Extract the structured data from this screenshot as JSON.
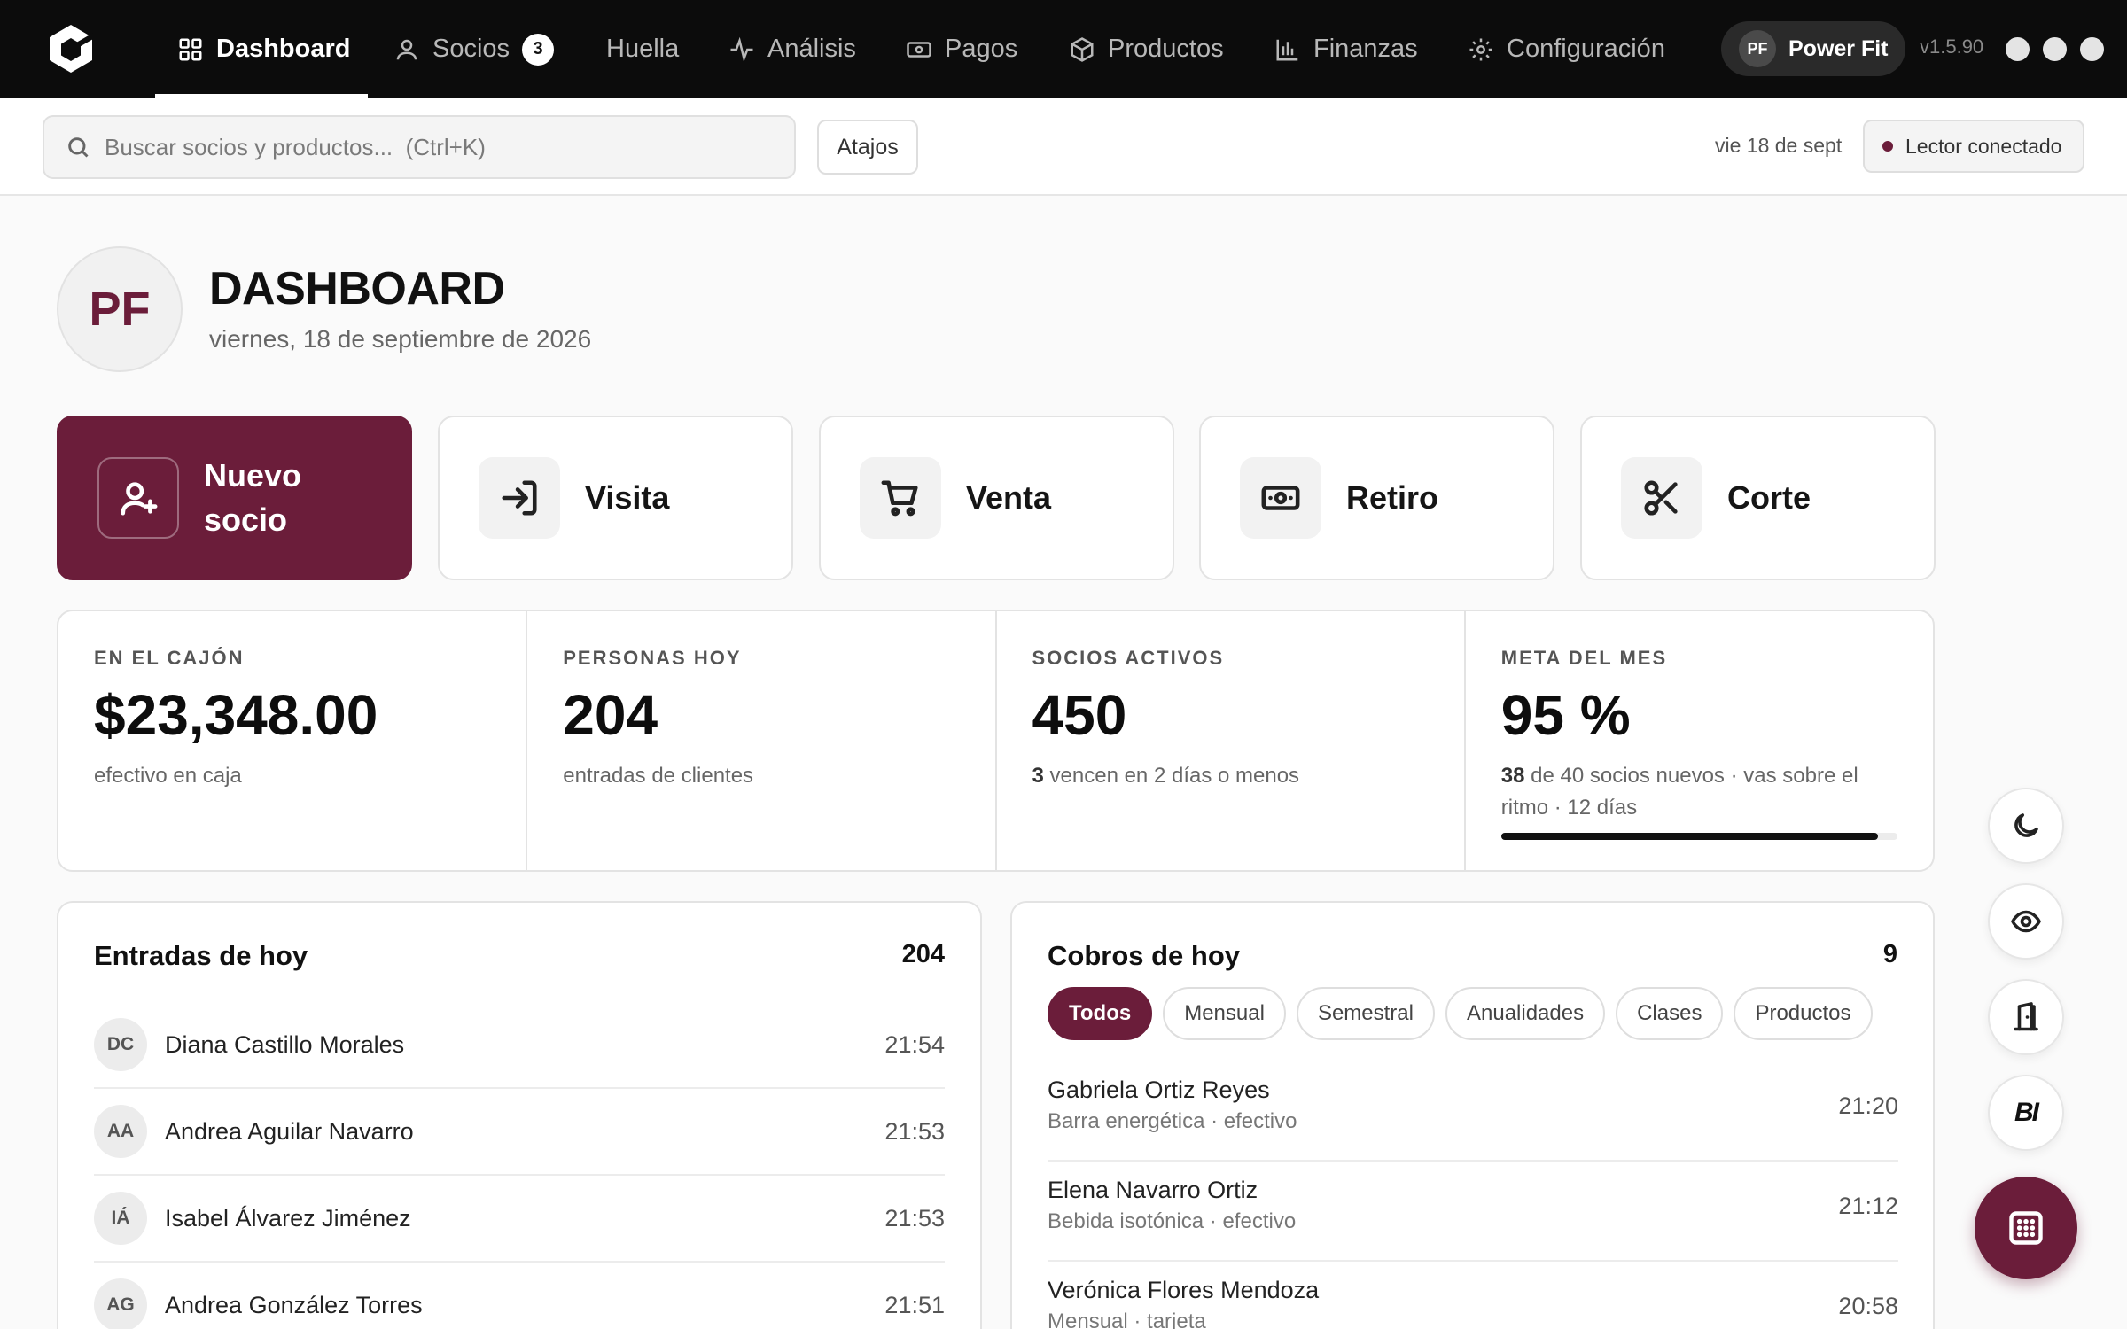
{
  "nav": {
    "items": [
      {
        "label": "Dashboard",
        "icon": "grid-icon",
        "active": true
      },
      {
        "label": "Socios",
        "icon": "user-icon",
        "badge": "3"
      },
      {
        "label": "Huella",
        "icon": ""
      },
      {
        "label": "Análisis",
        "icon": "activity-icon"
      },
      {
        "label": "Pagos",
        "icon": "cash-icon"
      },
      {
        "label": "Productos",
        "icon": "box-icon"
      },
      {
        "label": "Finanzas",
        "icon": "bar-chart-icon"
      },
      {
        "label": "Configuración",
        "icon": "gear-icon"
      }
    ],
    "brand": {
      "initials": "PF",
      "name": "Power Fit"
    },
    "version": "v1.5.90"
  },
  "toolbar": {
    "search_placeholder": "Buscar socios y productos...  (Ctrl+K)",
    "shortcuts_label": "Atajos",
    "date_short": "vie 18 de sept",
    "reader_status": "Lector conectado"
  },
  "header": {
    "initials": "PF",
    "title": "DASHBOARD",
    "date": "viernes, 18 de septiembre de 2026"
  },
  "actions": [
    {
      "label": "Nuevo socio",
      "icon": "user-plus-icon"
    },
    {
      "label": "Visita",
      "icon": "login-icon"
    },
    {
      "label": "Venta",
      "icon": "cart-icon"
    },
    {
      "label": "Retiro",
      "icon": "banknote-icon"
    },
    {
      "label": "Corte",
      "icon": "scissors-icon"
    }
  ],
  "stats": [
    {
      "label": "EN EL CAJÓN",
      "value": "$23,348.00",
      "sub": "efectivo en caja"
    },
    {
      "label": "PERSONAS HOY",
      "value": "204",
      "sub": "entradas de clientes"
    },
    {
      "label": "SOCIOS ACTIVOS",
      "value": "450",
      "sub_strong": "3",
      "sub": " vencen en 2 días o menos"
    },
    {
      "label": "META DEL MES",
      "value": "95 %",
      "sub_strong": "38",
      "sub": " de 40 socios nuevos · vas sobre el ritmo · 12 días",
      "progress": 0.95
    }
  ],
  "entries": {
    "title": "Entradas de hoy",
    "count": "204",
    "rows": [
      {
        "initials": "DC",
        "name": "Diana Castillo Morales",
        "time": "21:54"
      },
      {
        "initials": "AA",
        "name": "Andrea Aguilar Navarro",
        "time": "21:53"
      },
      {
        "initials": "IÁ",
        "name": "Isabel Álvarez Jiménez",
        "time": "21:53"
      },
      {
        "initials": "AG",
        "name": "Andrea González Torres",
        "time": "21:51"
      }
    ]
  },
  "charges": {
    "title": "Cobros de hoy",
    "count": "9",
    "filters": [
      "Todos",
      "Mensual",
      "Semestral",
      "Anualidades",
      "Clases",
      "Productos"
    ],
    "active_filter": "Todos",
    "rows": [
      {
        "name": "Gabriela Ortiz Reyes",
        "detail": "Barra energética · efectivo",
        "time": "21:20"
      },
      {
        "name": "Elena Navarro Ortiz",
        "detail": "Bebida isotónica · efectivo",
        "time": "21:12"
      },
      {
        "name": "Verónica Flores Mendoza",
        "detail": "Mensual · tarjeta",
        "time": "20:58"
      }
    ]
  },
  "floating": [
    {
      "icon": "moon-icon"
    },
    {
      "icon": "eye-icon"
    },
    {
      "icon": "door-icon"
    },
    {
      "icon": "bi-logo",
      "text": "BI"
    },
    {
      "icon": "keypad-icon"
    }
  ],
  "colors": {
    "accent": "#6b1d3a",
    "topbar": "#0c0c0c",
    "background": "#fafafa"
  }
}
